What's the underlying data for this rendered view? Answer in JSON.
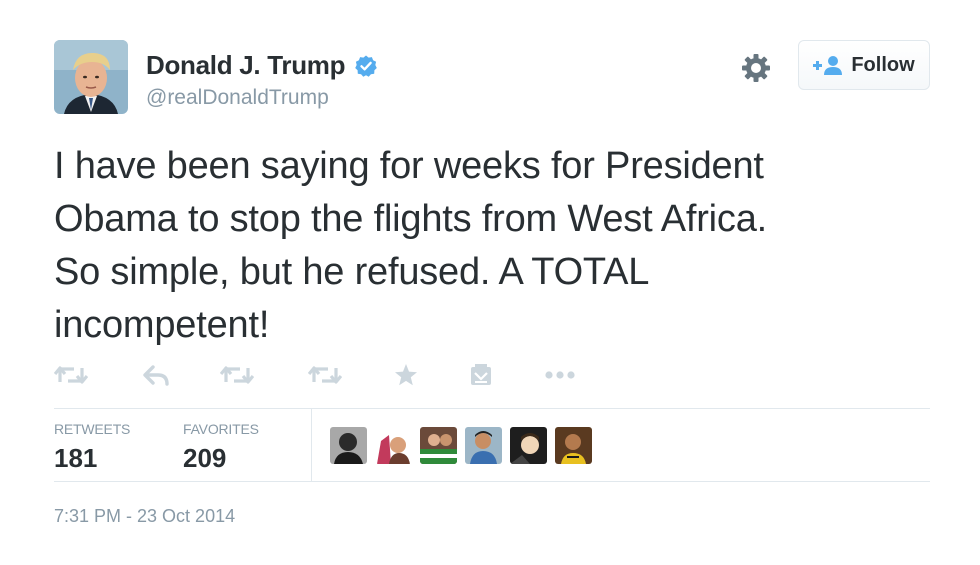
{
  "author": {
    "display_name": "Donald J. Trump",
    "handle": "@realDonaldTrump",
    "verified": true
  },
  "follow_button": {
    "label": "Follow"
  },
  "tweet": {
    "text_lines": [
      "I have been saying for weeks for President",
      "Obama to stop the flights from West Africa.",
      "So simple, but he refused. A TOTAL",
      "incompetent!"
    ]
  },
  "actions": [
    "retweet-icon",
    "reply-icon",
    "retweet-icon",
    "retweet-icon",
    "favorite-icon",
    "embed-icon",
    "more-icon"
  ],
  "stats": {
    "retweets_label": "RETWEETS",
    "retweets_count": "181",
    "favorites_label": "FAVORITES",
    "favorites_count": "209"
  },
  "favoriters_count_shown": 6,
  "timestamp": "7:31 PM - 23 Oct 2014",
  "colors": {
    "text": "#292f33",
    "muted": "#8899a6",
    "action_icon": "#ccd6dd",
    "verified_blue": "#55acee",
    "border": "#e1e8ed"
  }
}
